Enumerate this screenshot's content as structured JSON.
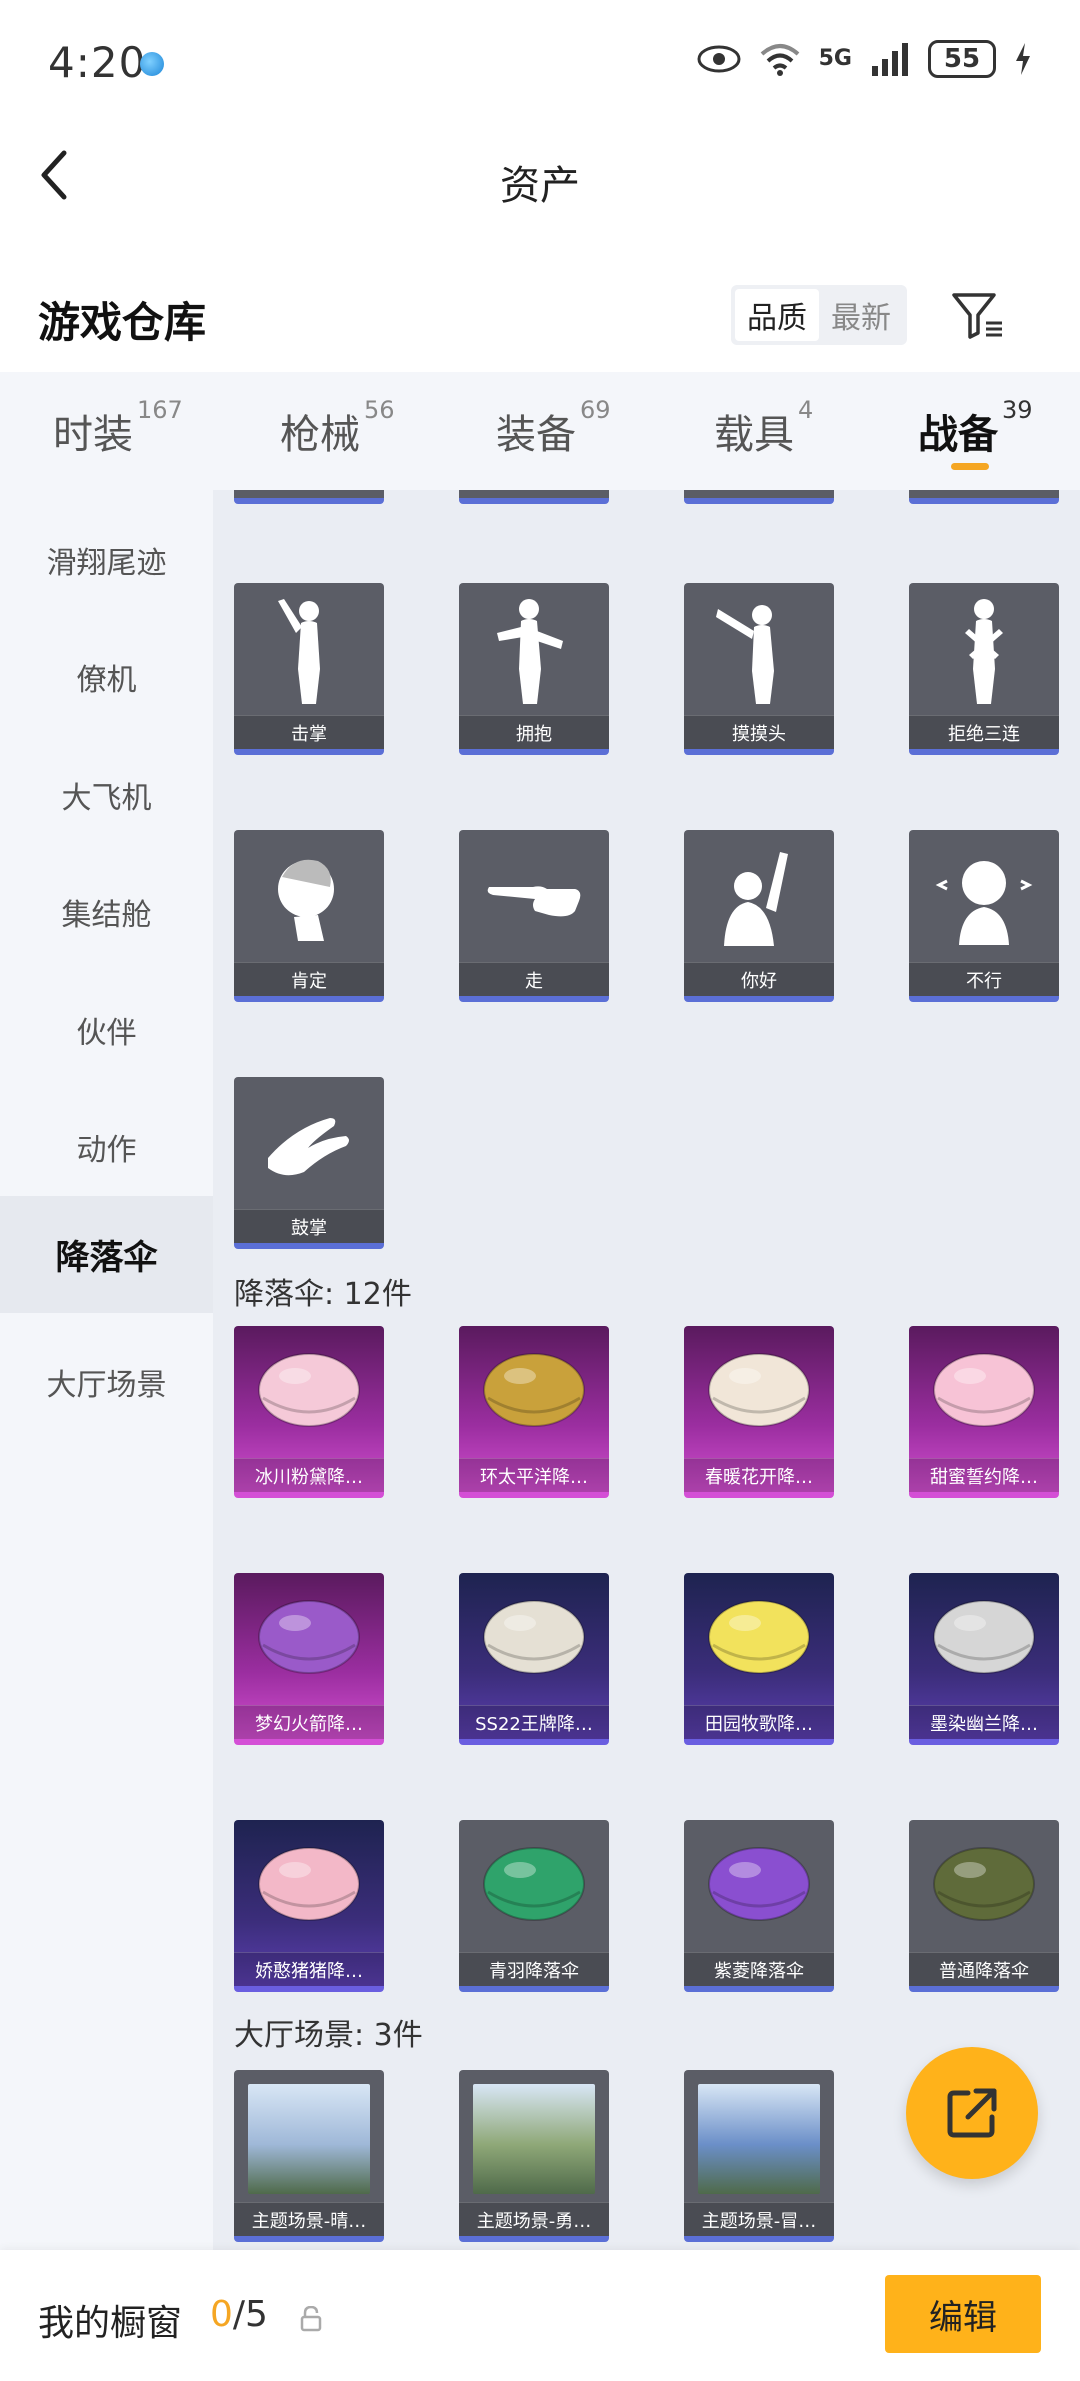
{
  "status_bar": {
    "time": "4:20",
    "network": "5G",
    "battery": "55"
  },
  "header": {
    "title": "资产"
  },
  "warehouse": {
    "title": "游戏仓库",
    "sort_options": [
      "品质",
      "最新"
    ],
    "sort_selected": "品质"
  },
  "tabs": [
    {
      "label": "时装",
      "count": "167"
    },
    {
      "label": "枪械",
      "count": "56"
    },
    {
      "label": "装备",
      "count": "69"
    },
    {
      "label": "载具",
      "count": "4"
    },
    {
      "label": "战备",
      "count": "39",
      "active": true
    }
  ],
  "sidebar": {
    "items": [
      {
        "label": "滑翔尾迹"
      },
      {
        "label": "僚机"
      },
      {
        "label": "大飞机"
      },
      {
        "label": "集结舱"
      },
      {
        "label": "伙伴"
      },
      {
        "label": "动作"
      },
      {
        "label": "降落伞",
        "active": true
      },
      {
        "label": "大厅场景"
      }
    ]
  },
  "emotes": [
    {
      "label": "击掌",
      "icon": "emote-high-five-icon"
    },
    {
      "label": "拥抱",
      "icon": "emote-hug-icon"
    },
    {
      "label": "摸摸头",
      "icon": "emote-pat-head-icon"
    },
    {
      "label": "拒绝三连",
      "icon": "emote-refuse-icon"
    },
    {
      "label": "肯定",
      "icon": "emote-nod-icon"
    },
    {
      "label": "走",
      "icon": "emote-point-icon"
    },
    {
      "label": "你好",
      "icon": "emote-wave-icon"
    },
    {
      "label": "不行",
      "icon": "emote-shake-head-icon"
    },
    {
      "label": "鼓掌",
      "icon": "emote-clap-icon"
    }
  ],
  "parachute_section": {
    "title": "降落伞: 12件"
  },
  "parachutes": [
    {
      "label": "冰川粉黛降…",
      "rarity": "purple",
      "color": "#f5c9d8"
    },
    {
      "label": "环太平洋降…",
      "rarity": "purple",
      "color": "#c9a13b"
    },
    {
      "label": "春暖花开降…",
      "rarity": "purple",
      "color": "#f1e6d8"
    },
    {
      "label": "甜蜜誓约降…",
      "rarity": "purple",
      "color": "#f7c3d6"
    },
    {
      "label": "梦幻火箭降…",
      "rarity": "purple",
      "color": "#9a5ac9"
    },
    {
      "label": "SS22王牌降…",
      "rarity": "blue",
      "color": "#e5e0d4"
    },
    {
      "label": "田园牧歌降…",
      "rarity": "blue",
      "color": "#f2e25c"
    },
    {
      "label": "墨染幽兰降…",
      "rarity": "blue",
      "color": "#d6d6d6"
    },
    {
      "label": "娇憨猪猪降…",
      "rarity": "blue",
      "color": "#f3b8c8"
    },
    {
      "label": "青羽降落伞",
      "rarity": "gray",
      "color": "#2fa36b"
    },
    {
      "label": "紫菱降落伞",
      "rarity": "gray",
      "color": "#8a4fd0"
    },
    {
      "label": "普通降落伞",
      "rarity": "gray",
      "color": "#5f6b3a"
    }
  ],
  "scene_section": {
    "title": "大厅场景: 3件"
  },
  "scenes": [
    {
      "label": "主题场景-晴…",
      "color": "#9fb8d8"
    },
    {
      "label": "主题场景-勇…",
      "color": "#8fa878"
    },
    {
      "label": "主题场景-冒…",
      "color": "#6b8fc8"
    }
  ],
  "bottom_bar": {
    "label": "我的橱窗",
    "count_current": "0",
    "count_total": "/5",
    "edit_label": "编辑"
  }
}
